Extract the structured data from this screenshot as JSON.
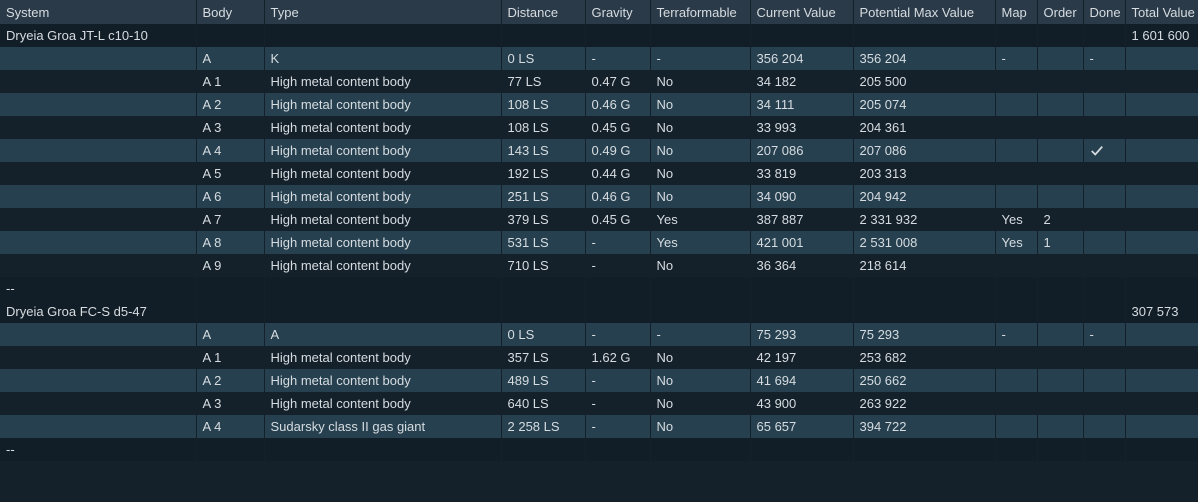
{
  "columns": [
    "System",
    "Body",
    "Type",
    "Distance",
    "Gravity",
    "Terraformable",
    "Current Value",
    "Potential Max Value",
    "Map",
    "Order",
    "Done",
    "Total Value"
  ],
  "systems": [
    {
      "name": "Dryeia Groa JT-L c10-10",
      "total_value": "1 601 600",
      "bodies": [
        {
          "body": "A",
          "type": "K",
          "distance": "0 LS",
          "gravity": "-",
          "terraformable": "-",
          "current": "356 204",
          "potential": "356 204",
          "map": "-",
          "order": "",
          "done": "-"
        },
        {
          "body": "A 1",
          "type": "High metal content body",
          "distance": "77 LS",
          "gravity": "0.47 G",
          "terraformable": "No",
          "current": "34 182",
          "potential": "205 500",
          "map": "",
          "order": "",
          "done": ""
        },
        {
          "body": "A 2",
          "type": "High metal content body",
          "distance": "108 LS",
          "gravity": "0.46 G",
          "terraformable": "No",
          "current": "34 111",
          "potential": "205 074",
          "map": "",
          "order": "",
          "done": ""
        },
        {
          "body": "A 3",
          "type": "High metal content body",
          "distance": "108 LS",
          "gravity": "0.45 G",
          "terraformable": "No",
          "current": "33 993",
          "potential": "204 361",
          "map": "",
          "order": "",
          "done": ""
        },
        {
          "body": "A 4",
          "type": "High metal content body",
          "distance": "143 LS",
          "gravity": "0.49 G",
          "terraformable": "No",
          "current": "207 086",
          "potential": "207 086",
          "map": "",
          "order": "",
          "done": "__check__"
        },
        {
          "body": "A 5",
          "type": "High metal content body",
          "distance": "192 LS",
          "gravity": "0.44 G",
          "terraformable": "No",
          "current": "33 819",
          "potential": "203 313",
          "map": "",
          "order": "",
          "done": ""
        },
        {
          "body": "A 6",
          "type": "High metal content body",
          "distance": "251 LS",
          "gravity": "0.46 G",
          "terraformable": "No",
          "current": "34 090",
          "potential": "204 942",
          "map": "",
          "order": "",
          "done": ""
        },
        {
          "body": "A 7",
          "type": "High metal content body",
          "distance": "379 LS",
          "gravity": "0.45 G",
          "terraformable": "Yes",
          "current": "387 887",
          "potential": "2 331 932",
          "map": "Yes",
          "order": "2",
          "done": ""
        },
        {
          "body": "A 8",
          "type": "High metal content body",
          "distance": "531 LS",
          "gravity": "-",
          "terraformable": "Yes",
          "current": "421 001",
          "potential": "2 531 008",
          "map": "Yes",
          "order": "1",
          "done": ""
        },
        {
          "body": "A 9",
          "type": "High metal content body",
          "distance": "710 LS",
          "gravity": "-",
          "terraformable": "No",
          "current": "36 364",
          "potential": "218 614",
          "map": "",
          "order": "",
          "done": ""
        }
      ]
    },
    {
      "name": "Dryeia Groa FC-S d5-47",
      "total_value": "307 573",
      "bodies": [
        {
          "body": "A",
          "type": "A",
          "distance": "0 LS",
          "gravity": "-",
          "terraformable": "-",
          "current": "75 293",
          "potential": "75 293",
          "map": "-",
          "order": "",
          "done": "-"
        },
        {
          "body": "A 1",
          "type": "High metal content body",
          "distance": "357 LS",
          "gravity": "1.62 G",
          "terraformable": "No",
          "current": "42 197",
          "potential": "253 682",
          "map": "",
          "order": "",
          "done": ""
        },
        {
          "body": "A 2",
          "type": "High metal content body",
          "distance": "489 LS",
          "gravity": "-",
          "terraformable": "No",
          "current": "41 694",
          "potential": "250 662",
          "map": "",
          "order": "",
          "done": ""
        },
        {
          "body": "A 3",
          "type": "High metal content body",
          "distance": "640 LS",
          "gravity": "-",
          "terraformable": "No",
          "current": "43 900",
          "potential": "263 922",
          "map": "",
          "order": "",
          "done": ""
        },
        {
          "body": "A 4",
          "type": "Sudarsky class II gas giant",
          "distance": "2 258 LS",
          "gravity": "-",
          "terraformable": "No",
          "current": "65 657",
          "potential": "394 722",
          "map": "",
          "order": "",
          "done": ""
        }
      ]
    }
  ],
  "separator": "--"
}
